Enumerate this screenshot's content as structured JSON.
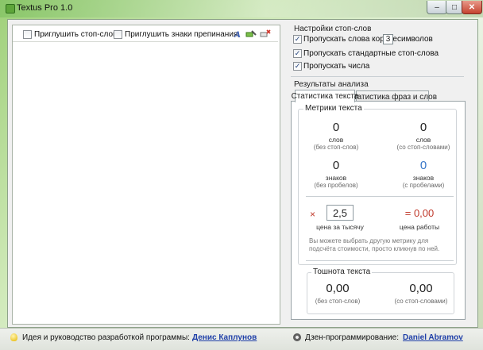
{
  "window": {
    "title": "Textus Pro 1.0",
    "minimize_label": "–",
    "maximize_label": "□",
    "close_label": "✕"
  },
  "editor": {
    "mute_stopwords_label": "Приглушить стоп-слова",
    "mute_punctuation_label": "Приглушить знаки препинания",
    "mute_stopwords_checked": false,
    "mute_punctuation_checked": false
  },
  "stopword_settings": {
    "title": "Настройки стоп-слов",
    "skip_short_words_label": "Пропускать слова короче",
    "skip_short_words_value": "3",
    "skip_short_words_unit": "символов",
    "skip_standard_stopwords_label": "Пропускать стандартные стоп-слова",
    "skip_numbers_label": "Пропускать числа",
    "skip_short_words_checked": true,
    "skip_standard_stopwords_checked": true,
    "skip_numbers_checked": true,
    "check_mark": "✓"
  },
  "analysis": {
    "title": "Результаты анализа",
    "tabs": [
      "Статистика текста",
      "Статистика фраз и слов"
    ],
    "metrics": {
      "title": "Метрики текста",
      "words_no_stop": {
        "value": "0",
        "label": "слов",
        "sub": "(без стоп-слов)"
      },
      "words_with_stop": {
        "value": "0",
        "label": "слов",
        "sub": "(со стоп-словами)"
      },
      "chars_no_spaces": {
        "value": "0",
        "label": "знаков",
        "sub": "(без пробелов)"
      },
      "chars_with_spaces": {
        "value": "0",
        "label": "знаков",
        "sub": "(с пробелами)"
      },
      "multiply_sign": "×",
      "price_per_thousand": "2,5",
      "price_per_thousand_label": "цена за тысячу",
      "work_price": "= 0,00",
      "work_price_label": "цена работы",
      "hint": "Вы можете выбрать другую метрику для подсчёта стоимости, просто кликнув по ней."
    },
    "nausea": {
      "title": "Тошнота текста",
      "no_stop": {
        "value": "0,00",
        "sub": "(без стоп-слов)"
      },
      "with_stop": {
        "value": "0,00",
        "sub": "(со стоп-словами)"
      }
    }
  },
  "statusbar": {
    "idea_text": "Идея и руководство разработкой программы:",
    "idea_author": "Денис Каплунов",
    "zen_text": "Дзен-программирование:",
    "zen_author": "Daniel Abramov"
  },
  "colors": {
    "accent_blue": "#3a78c9",
    "price_red": "#c0392b",
    "link": "#1f3fa8"
  }
}
